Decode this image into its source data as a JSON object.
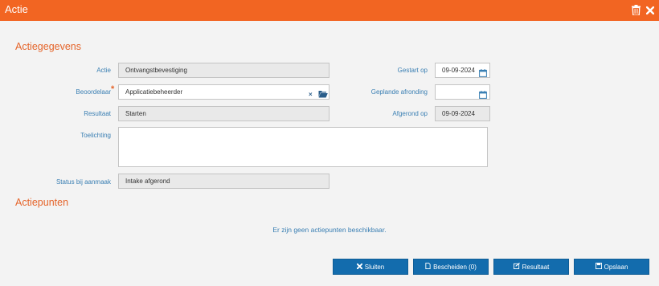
{
  "window": {
    "title": "Actie"
  },
  "sections": {
    "details_title": "Actiegegevens",
    "actionpoints_title": "Actiepunten"
  },
  "form": {
    "actie_label": "Actie",
    "actie_value": "Ontvangstbevestiging",
    "beoordelaar_label": "Beoordelaar",
    "beoordelaar_value": "Applicatiebeheerder",
    "resultaat_label": "Resultaat",
    "resultaat_value": "Starten",
    "toelichting_label": "Toelichting",
    "toelichting_value": "",
    "status_label": "Status bij aanmaak",
    "status_value": "Intake afgerond",
    "gestart_label": "Gestart op",
    "gestart_value": "09-09-2024",
    "gepland_label": "Geplande afronding",
    "gepland_value": "",
    "afgerond_label": "Afgerond op",
    "afgerond_value": "09-09-2024",
    "required_mark": "*",
    "clear_glyph": "×"
  },
  "actiepunten": {
    "empty_message": "Er zijn geen actiepunten beschikbaar."
  },
  "buttons": {
    "close": "Sluiten",
    "documents": "Bescheiden (0)",
    "result": "Resultaat",
    "save": "Opslaan"
  },
  "icons": {
    "trash": "trash-icon",
    "close": "close-icon",
    "calendar": "calendar-icon",
    "folder": "folder-open-icon",
    "save": "floppy-icon",
    "document": "document-icon",
    "edit": "edit-icon"
  },
  "colors": {
    "accent": "#f26522",
    "heading": "#e5642a",
    "label": "#3a7fb3",
    "button": "#136cad"
  }
}
